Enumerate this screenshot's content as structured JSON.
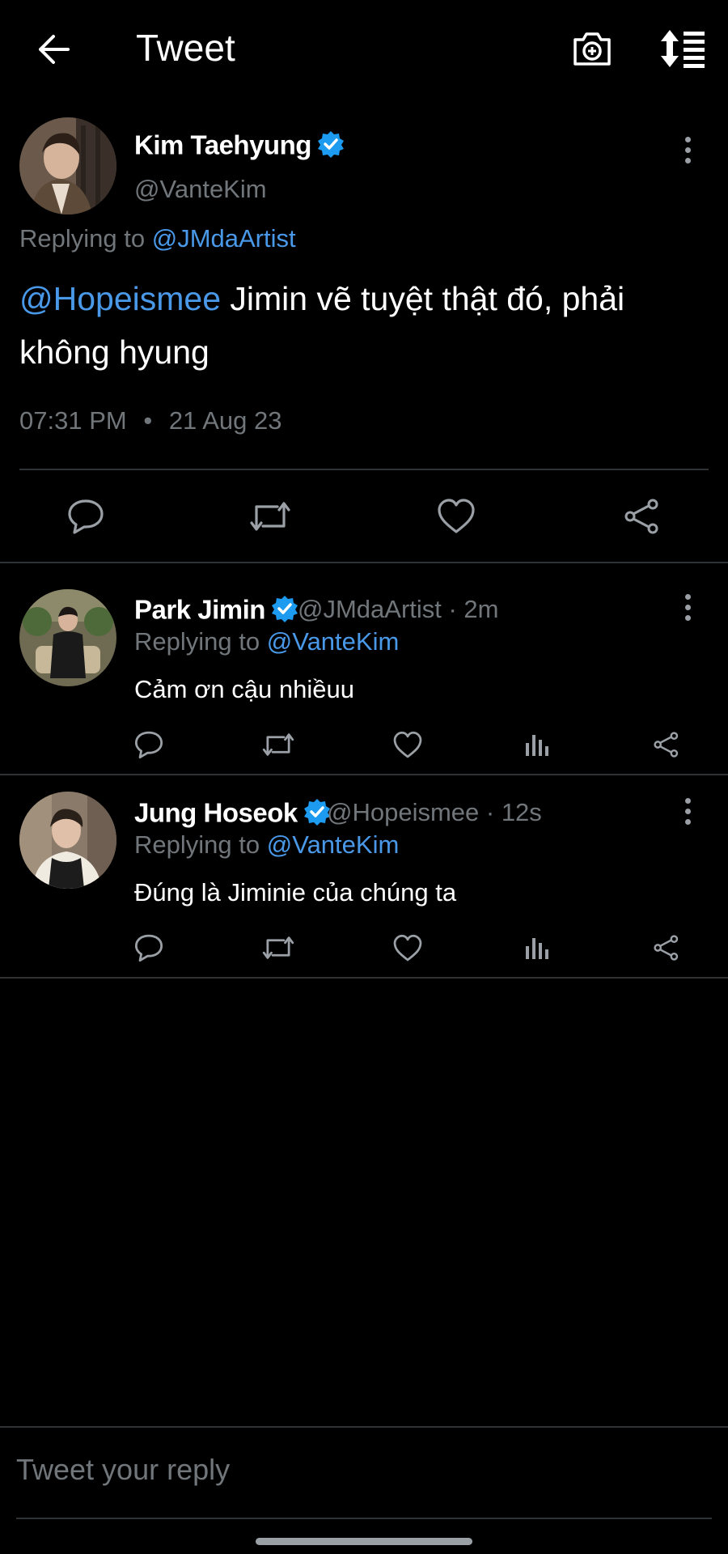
{
  "header": {
    "title": "Tweet",
    "back_icon": "arrow-left-icon",
    "camera_icon": "camera-plus-icon",
    "sort_icon": "sort-list-icon"
  },
  "main_tweet": {
    "name": "Kim Taehyung",
    "handle": "@VanteKim",
    "replying_prefix": "Replying to",
    "replying_to": "@JMdaArtist",
    "mention": "@Hopeismee",
    "text": " Jimin vẽ tuyệt thật đó, phải không hyung",
    "time": "07:31 PM",
    "separator": "•",
    "date": "21 Aug 23"
  },
  "replies": [
    {
      "name": "Park Jimin",
      "handle_time": "@JMdaArtist · 2m",
      "replying_prefix": "Replying to",
      "replying_to": "@VanteKim",
      "text": "Cảm ơn cậu nhiềuu"
    },
    {
      "name": "Jung Hoseok",
      "handle_time": "@Hopeismee · 12s",
      "replying_prefix": "Replying to",
      "replying_to": "@VanteKim",
      "text": "Đúng là Jiminie của chúng ta"
    }
  ],
  "composer": {
    "placeholder": "Tweet your reply"
  },
  "colors": {
    "background": "#000000",
    "link": "#4a99e9",
    "muted": "#71767b",
    "verified": "#1d9bf0"
  }
}
